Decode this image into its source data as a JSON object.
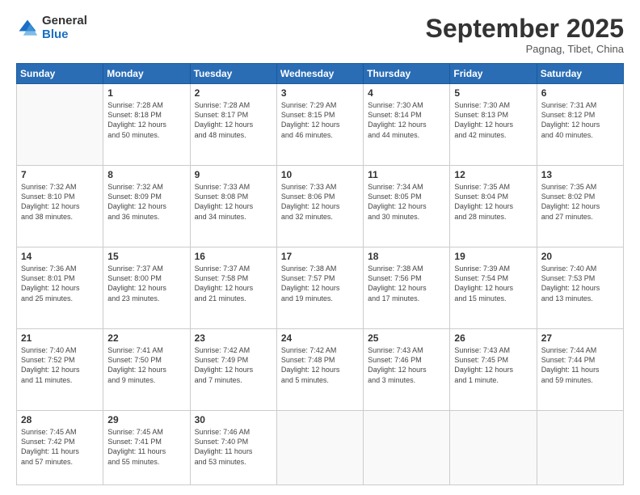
{
  "logo": {
    "general": "General",
    "blue": "Blue"
  },
  "title": "September 2025",
  "subtitle": "Pagnag, Tibet, China",
  "days_header": [
    "Sunday",
    "Monday",
    "Tuesday",
    "Wednesday",
    "Thursday",
    "Friday",
    "Saturday"
  ],
  "weeks": [
    [
      {
        "num": "",
        "info": ""
      },
      {
        "num": "1",
        "info": "Sunrise: 7:28 AM\nSunset: 8:18 PM\nDaylight: 12 hours\nand 50 minutes."
      },
      {
        "num": "2",
        "info": "Sunrise: 7:28 AM\nSunset: 8:17 PM\nDaylight: 12 hours\nand 48 minutes."
      },
      {
        "num": "3",
        "info": "Sunrise: 7:29 AM\nSunset: 8:15 PM\nDaylight: 12 hours\nand 46 minutes."
      },
      {
        "num": "4",
        "info": "Sunrise: 7:30 AM\nSunset: 8:14 PM\nDaylight: 12 hours\nand 44 minutes."
      },
      {
        "num": "5",
        "info": "Sunrise: 7:30 AM\nSunset: 8:13 PM\nDaylight: 12 hours\nand 42 minutes."
      },
      {
        "num": "6",
        "info": "Sunrise: 7:31 AM\nSunset: 8:12 PM\nDaylight: 12 hours\nand 40 minutes."
      }
    ],
    [
      {
        "num": "7",
        "info": "Sunrise: 7:32 AM\nSunset: 8:10 PM\nDaylight: 12 hours\nand 38 minutes."
      },
      {
        "num": "8",
        "info": "Sunrise: 7:32 AM\nSunset: 8:09 PM\nDaylight: 12 hours\nand 36 minutes."
      },
      {
        "num": "9",
        "info": "Sunrise: 7:33 AM\nSunset: 8:08 PM\nDaylight: 12 hours\nand 34 minutes."
      },
      {
        "num": "10",
        "info": "Sunrise: 7:33 AM\nSunset: 8:06 PM\nDaylight: 12 hours\nand 32 minutes."
      },
      {
        "num": "11",
        "info": "Sunrise: 7:34 AM\nSunset: 8:05 PM\nDaylight: 12 hours\nand 30 minutes."
      },
      {
        "num": "12",
        "info": "Sunrise: 7:35 AM\nSunset: 8:04 PM\nDaylight: 12 hours\nand 28 minutes."
      },
      {
        "num": "13",
        "info": "Sunrise: 7:35 AM\nSunset: 8:02 PM\nDaylight: 12 hours\nand 27 minutes."
      }
    ],
    [
      {
        "num": "14",
        "info": "Sunrise: 7:36 AM\nSunset: 8:01 PM\nDaylight: 12 hours\nand 25 minutes."
      },
      {
        "num": "15",
        "info": "Sunrise: 7:37 AM\nSunset: 8:00 PM\nDaylight: 12 hours\nand 23 minutes."
      },
      {
        "num": "16",
        "info": "Sunrise: 7:37 AM\nSunset: 7:58 PM\nDaylight: 12 hours\nand 21 minutes."
      },
      {
        "num": "17",
        "info": "Sunrise: 7:38 AM\nSunset: 7:57 PM\nDaylight: 12 hours\nand 19 minutes."
      },
      {
        "num": "18",
        "info": "Sunrise: 7:38 AM\nSunset: 7:56 PM\nDaylight: 12 hours\nand 17 minutes."
      },
      {
        "num": "19",
        "info": "Sunrise: 7:39 AM\nSunset: 7:54 PM\nDaylight: 12 hours\nand 15 minutes."
      },
      {
        "num": "20",
        "info": "Sunrise: 7:40 AM\nSunset: 7:53 PM\nDaylight: 12 hours\nand 13 minutes."
      }
    ],
    [
      {
        "num": "21",
        "info": "Sunrise: 7:40 AM\nSunset: 7:52 PM\nDaylight: 12 hours\nand 11 minutes."
      },
      {
        "num": "22",
        "info": "Sunrise: 7:41 AM\nSunset: 7:50 PM\nDaylight: 12 hours\nand 9 minutes."
      },
      {
        "num": "23",
        "info": "Sunrise: 7:42 AM\nSunset: 7:49 PM\nDaylight: 12 hours\nand 7 minutes."
      },
      {
        "num": "24",
        "info": "Sunrise: 7:42 AM\nSunset: 7:48 PM\nDaylight: 12 hours\nand 5 minutes."
      },
      {
        "num": "25",
        "info": "Sunrise: 7:43 AM\nSunset: 7:46 PM\nDaylight: 12 hours\nand 3 minutes."
      },
      {
        "num": "26",
        "info": "Sunrise: 7:43 AM\nSunset: 7:45 PM\nDaylight: 12 hours\nand 1 minute."
      },
      {
        "num": "27",
        "info": "Sunrise: 7:44 AM\nSunset: 7:44 PM\nDaylight: 11 hours\nand 59 minutes."
      }
    ],
    [
      {
        "num": "28",
        "info": "Sunrise: 7:45 AM\nSunset: 7:42 PM\nDaylight: 11 hours\nand 57 minutes."
      },
      {
        "num": "29",
        "info": "Sunrise: 7:45 AM\nSunset: 7:41 PM\nDaylight: 11 hours\nand 55 minutes."
      },
      {
        "num": "30",
        "info": "Sunrise: 7:46 AM\nSunset: 7:40 PM\nDaylight: 11 hours\nand 53 minutes."
      },
      {
        "num": "",
        "info": ""
      },
      {
        "num": "",
        "info": ""
      },
      {
        "num": "",
        "info": ""
      },
      {
        "num": "",
        "info": ""
      }
    ]
  ]
}
